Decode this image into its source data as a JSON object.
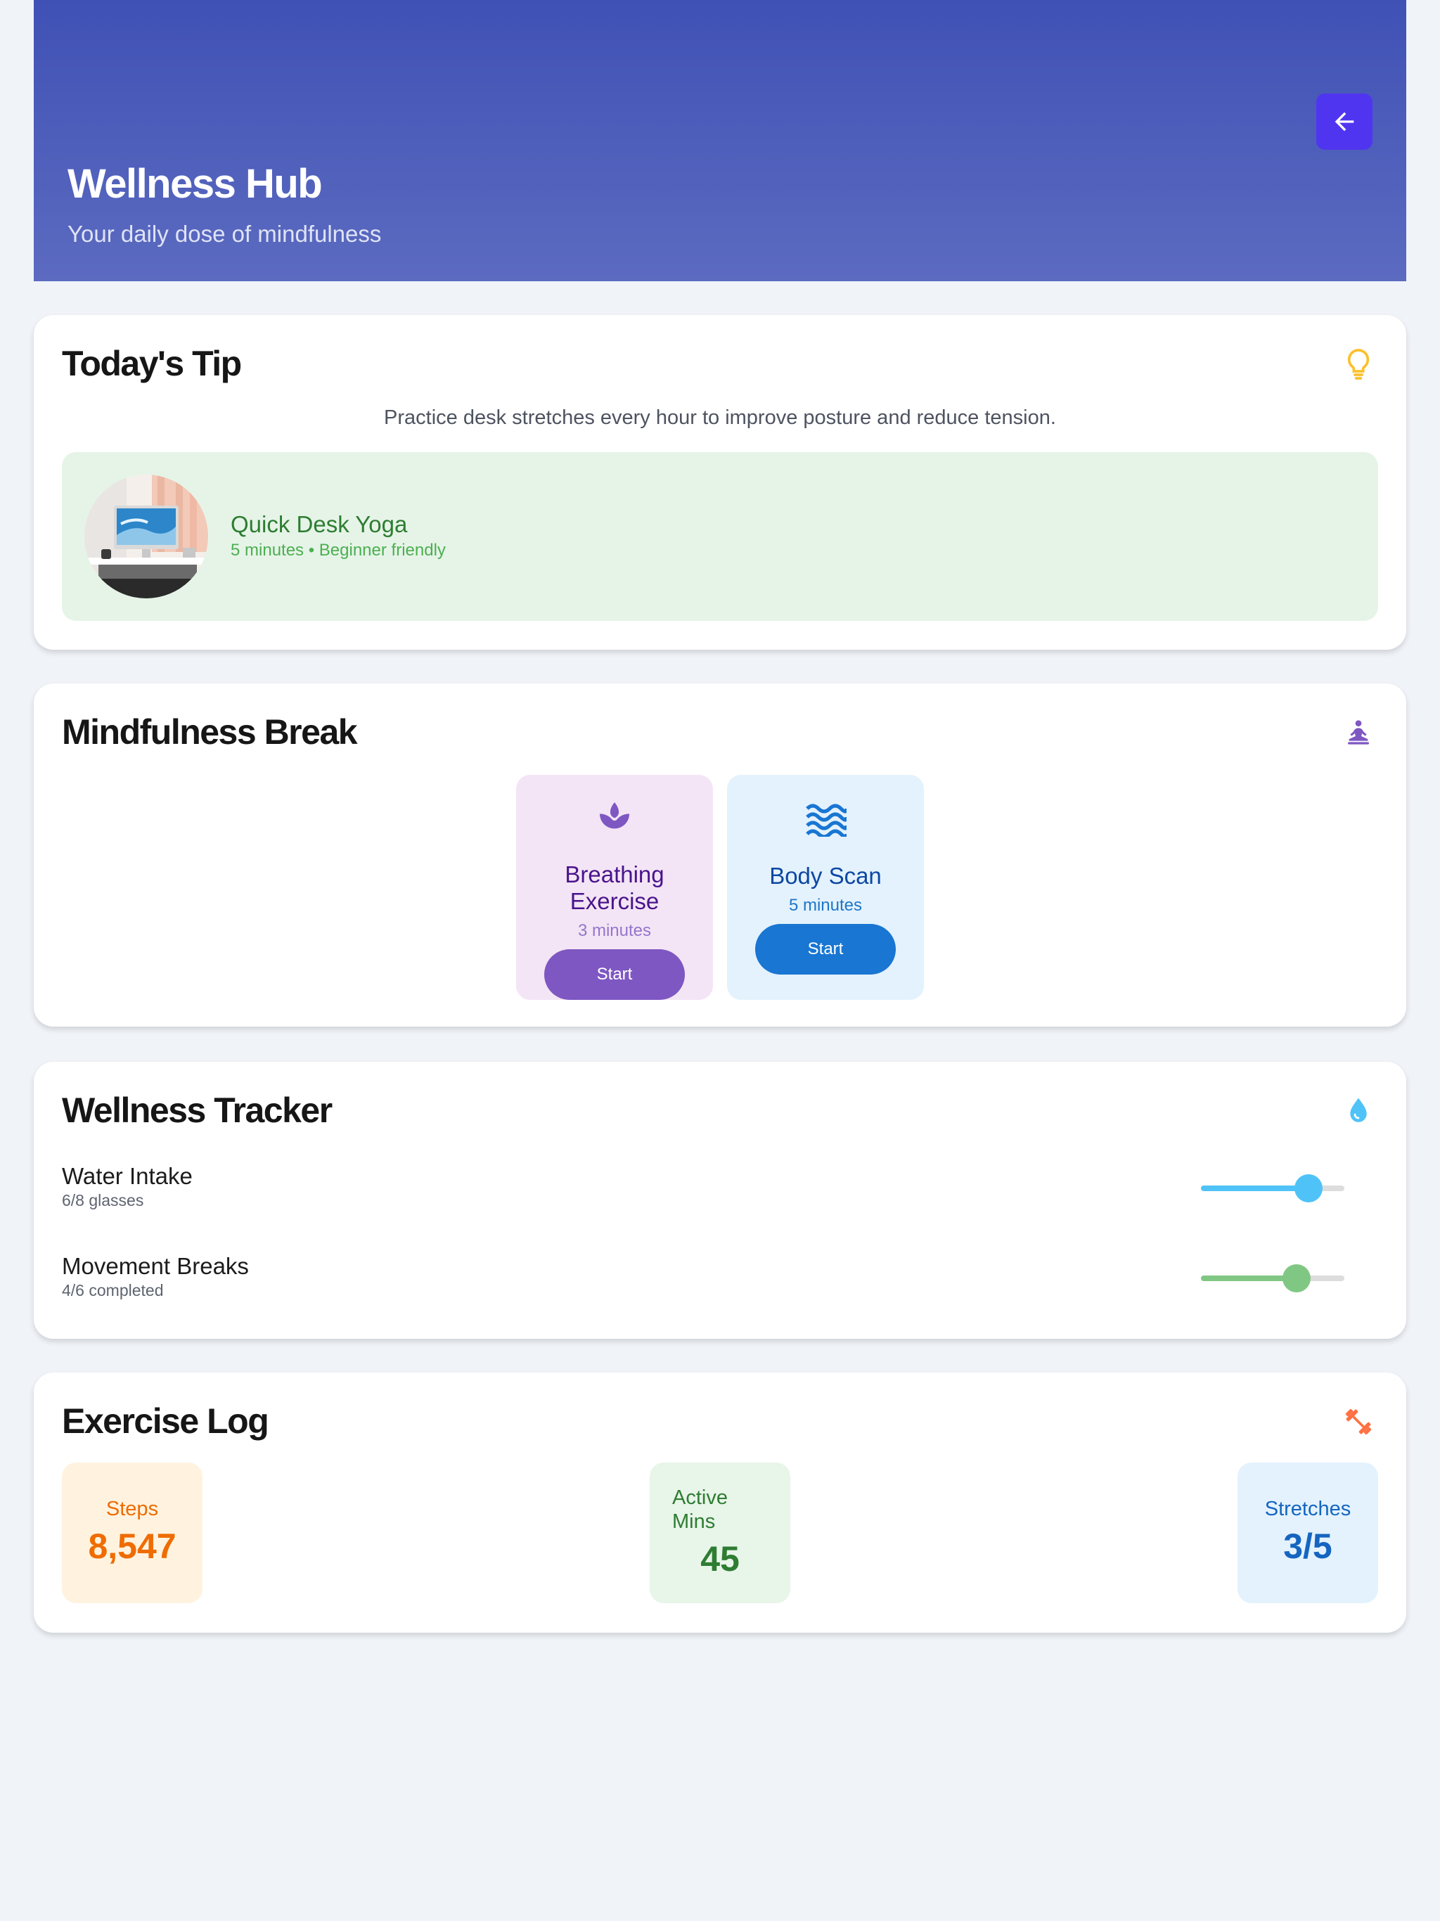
{
  "header": {
    "title": "Wellness Hub",
    "subtitle": "Your daily dose of mindfulness",
    "back_icon": "arrow-left-icon"
  },
  "tip": {
    "title": "Today's Tip",
    "icon": "lightbulb-icon",
    "text": "Practice desk stretches every hour to improve posture and reduce tension.",
    "activity_title": "Quick Desk Yoga",
    "activity_meta": "5 minutes • Beginner friendly"
  },
  "mindfulness": {
    "title": "Mindfulness Break",
    "icon": "meditation-icon",
    "items": [
      {
        "label_line1": "Breathing",
        "label_line2": "Exercise",
        "duration": "3 minutes",
        "button": "Start",
        "icon": "lotus-icon"
      },
      {
        "label": "Body Scan",
        "duration": "5 minutes",
        "button": "Start",
        "icon": "waves-icon"
      }
    ]
  },
  "tracker": {
    "title": "Wellness Tracker",
    "icon": "water-drop-icon",
    "items": [
      {
        "label": "Water Intake",
        "detail": "6/8 glasses",
        "progress": 0.75,
        "color": "#4fc3f7"
      },
      {
        "label": "Movement Breaks",
        "detail": "4/6 completed",
        "progress": 0.667,
        "color": "#81c784"
      }
    ]
  },
  "exercise": {
    "title": "Exercise Log",
    "icon": "dumbbell-icon",
    "stats": [
      {
        "label": "Steps",
        "value": "8,547",
        "color": "#ef6c00",
        "bg": "#fff3e0"
      },
      {
        "label_line1": "Active",
        "label_line2": "Mins",
        "value": "45",
        "color": "#2e7d32",
        "bg": "#e8f5e9"
      },
      {
        "label": "Stretches",
        "value": "3/5",
        "color": "#1565c0",
        "bg": "#e3f2fd"
      }
    ]
  },
  "colors": {
    "header_start": "#3f51b5",
    "header_end": "#5c6bc0",
    "back_button": "#5035f0",
    "purple": "#7e57c2",
    "blue": "#1976d2"
  }
}
